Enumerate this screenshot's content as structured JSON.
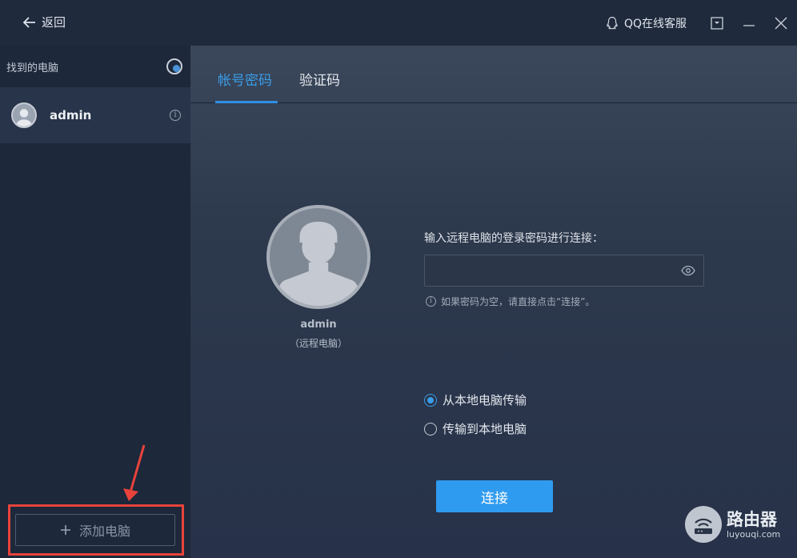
{
  "titlebar": {
    "back_label": "返回",
    "support_label": "QQ在线客服"
  },
  "sidebar": {
    "found_label": "找到的电脑",
    "computers": [
      {
        "name": "admin"
      }
    ],
    "add_label": "添加电脑"
  },
  "tabs": [
    {
      "label": "帐号密码",
      "active": true
    },
    {
      "label": "验证码",
      "active": false
    }
  ],
  "remote": {
    "name": "admin",
    "subtitle": "（远程电脑）"
  },
  "password": {
    "prompt": "输入远程电脑的登录密码进行连接：",
    "value": "",
    "hint": "如果密码为空，请直接点击“连接”。"
  },
  "transfer": {
    "options": [
      {
        "label": "从本地电脑传输",
        "checked": true
      },
      {
        "label": "传输到本地电脑",
        "checked": false
      }
    ]
  },
  "connect_label": "连接",
  "watermark": {
    "title": "路由器",
    "url": "luyouqi.com"
  },
  "colors": {
    "accent": "#2f9bf0",
    "highlight": "#e8433b"
  }
}
